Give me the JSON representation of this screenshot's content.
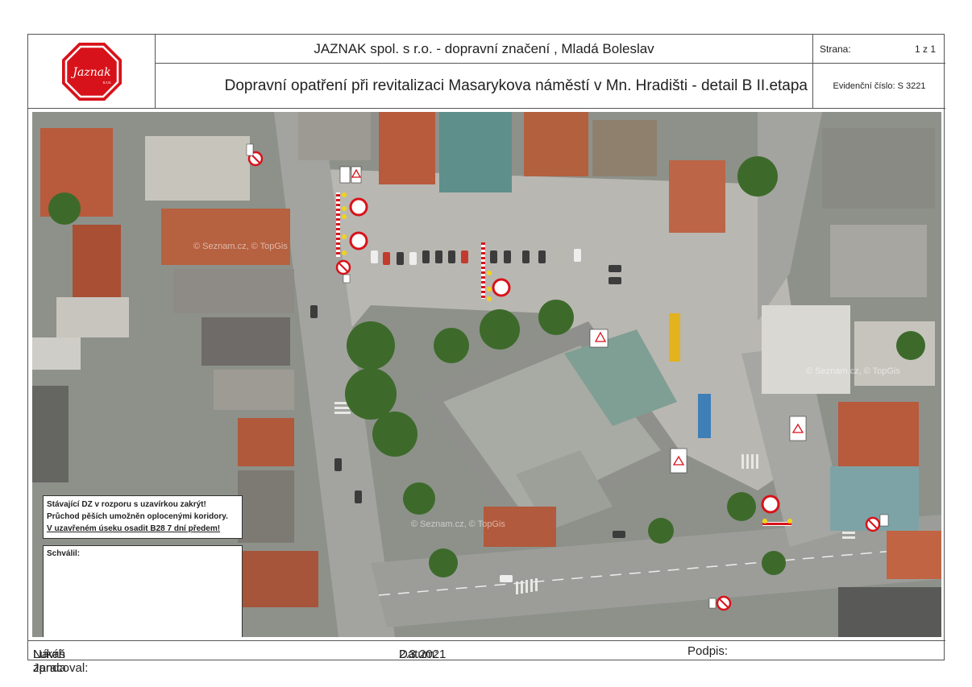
{
  "header": {
    "company": "JAZNAK spol. s r.o. - dopravní značení , Mladá Boleslav",
    "title": "Dopravní opatření při revitalizaci Masarykova náměstí v Mn. Hradišti - detail B  II.etapa",
    "page_label": "Strana:",
    "page_value": "1  z  1",
    "evid_label": "Evidenční číslo:",
    "evid_value": "S 3221",
    "logo_text": "Jaznak",
    "logo_sub": "s.r.o."
  },
  "notes": {
    "line1": "Stávající DZ v rozporu s uzavírkou zakrýt!",
    "line2": "Průchod pěších umožněn oplocenými koridory.",
    "line3": "V uzavřeném úseku osadit  B28 7 dní předem!"
  },
  "approval": {
    "label": "Schválil:"
  },
  "map": {
    "watermark": "© Seznam.cz, © TopGis"
  },
  "footer": {
    "author_label": "Návrh zpracoval:",
    "author": "Lukáš Janda",
    "date_label": "Datum:",
    "date": "2.3.2021",
    "signature_label": "Podpis:"
  },
  "colors": {
    "sign_red": "#d8121a",
    "roof_red": "#b85a3c",
    "square_paving": "#b9b7b2",
    "tree_green": "#3d6a2a"
  }
}
